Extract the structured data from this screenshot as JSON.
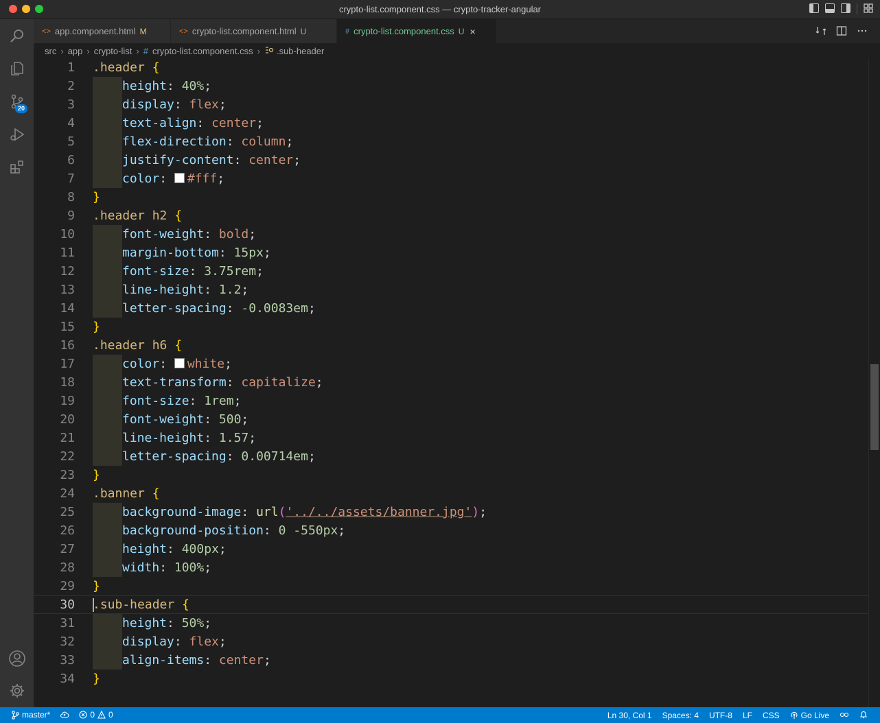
{
  "window": {
    "title": "crypto-list.component.css — crypto-tracker-angular"
  },
  "activity_bar": {
    "source_control_badge": "20",
    "items": [
      "search-icon",
      "explorer-icon",
      "source-control-icon",
      "run-debug-icon",
      "extensions-icon",
      "account-icon",
      "settings-gear-icon"
    ]
  },
  "tabs": [
    {
      "label": "app.component.html",
      "status": "M",
      "icon": "<>",
      "icon_color": "#e37933"
    },
    {
      "label": "crypto-list.component.html",
      "status": "U",
      "icon": "<>",
      "icon_color": "#e37933"
    },
    {
      "label": "crypto-list.component.css",
      "status": "U",
      "icon": "#",
      "icon_color": "#519aba",
      "active": true,
      "close": "×"
    }
  ],
  "breadcrumb": {
    "items": [
      "src",
      "app",
      "crypto-list",
      "crypto-list.component.css",
      ".sub-header"
    ],
    "file_icon": "#"
  },
  "editor": {
    "current_line": 30,
    "lines": [
      {
        "n": "1",
        "tokens": [
          [
            ".header",
            "sel"
          ],
          [
            " ",
            ""
          ],
          [
            "{",
            "brace"
          ]
        ]
      },
      {
        "n": "2",
        "indent": true,
        "tokens": [
          [
            "height",
            "prop"
          ],
          [
            ": ",
            ""
          ],
          [
            "40%",
            "num"
          ],
          [
            ";",
            ""
          ]
        ]
      },
      {
        "n": "3",
        "indent": true,
        "tokens": [
          [
            "display",
            "prop"
          ],
          [
            ": ",
            ""
          ],
          [
            "flex",
            "val"
          ],
          [
            ";",
            ""
          ]
        ]
      },
      {
        "n": "4",
        "indent": true,
        "tokens": [
          [
            "text-align",
            "prop"
          ],
          [
            ": ",
            ""
          ],
          [
            "center",
            "val"
          ],
          [
            ";",
            ""
          ]
        ]
      },
      {
        "n": "5",
        "indent": true,
        "tokens": [
          [
            "flex-direction",
            "prop"
          ],
          [
            ": ",
            ""
          ],
          [
            "column",
            "val"
          ],
          [
            ";",
            ""
          ]
        ]
      },
      {
        "n": "6",
        "indent": true,
        "tokens": [
          [
            "justify-content",
            "prop"
          ],
          [
            ": ",
            ""
          ],
          [
            "center",
            "val"
          ],
          [
            ";",
            ""
          ]
        ]
      },
      {
        "n": "7",
        "indent": true,
        "tokens": [
          [
            "color",
            "prop"
          ],
          [
            ": ",
            ""
          ],
          [
            "",
            "swatch"
          ],
          [
            "#fff",
            "val"
          ],
          [
            ";",
            ""
          ]
        ]
      },
      {
        "n": "8",
        "tokens": [
          [
            "}",
            "brace"
          ]
        ]
      },
      {
        "n": "9",
        "tokens": [
          [
            ".header h2",
            "sel"
          ],
          [
            " ",
            ""
          ],
          [
            "{",
            "brace"
          ]
        ]
      },
      {
        "n": "10",
        "indent": true,
        "tokens": [
          [
            "font-weight",
            "prop"
          ],
          [
            ": ",
            ""
          ],
          [
            "bold",
            "val"
          ],
          [
            ";",
            ""
          ]
        ]
      },
      {
        "n": "11",
        "indent": true,
        "tokens": [
          [
            "margin-bottom",
            "prop"
          ],
          [
            ": ",
            ""
          ],
          [
            "15px",
            "num"
          ],
          [
            ";",
            ""
          ]
        ]
      },
      {
        "n": "12",
        "indent": true,
        "tokens": [
          [
            "font-size",
            "prop"
          ],
          [
            ": ",
            ""
          ],
          [
            "3.75rem",
            "num"
          ],
          [
            ";",
            ""
          ]
        ]
      },
      {
        "n": "13",
        "indent": true,
        "tokens": [
          [
            "line-height",
            "prop"
          ],
          [
            ": ",
            ""
          ],
          [
            "1.2",
            "num"
          ],
          [
            ";",
            ""
          ]
        ]
      },
      {
        "n": "14",
        "indent": true,
        "tokens": [
          [
            "letter-spacing",
            "prop"
          ],
          [
            ": ",
            ""
          ],
          [
            "-0.0083em",
            "num"
          ],
          [
            ";",
            ""
          ]
        ]
      },
      {
        "n": "15",
        "tokens": [
          [
            "}",
            "brace"
          ]
        ]
      },
      {
        "n": "16",
        "tokens": [
          [
            ".header h6",
            "sel"
          ],
          [
            " ",
            ""
          ],
          [
            "{",
            "brace"
          ]
        ]
      },
      {
        "n": "17",
        "indent": true,
        "tokens": [
          [
            "color",
            "prop"
          ],
          [
            ": ",
            ""
          ],
          [
            "",
            "swatch"
          ],
          [
            "white",
            "val"
          ],
          [
            ";",
            ""
          ]
        ]
      },
      {
        "n": "18",
        "indent": true,
        "tokens": [
          [
            "text-transform",
            "prop"
          ],
          [
            ": ",
            ""
          ],
          [
            "capitalize",
            "val"
          ],
          [
            ";",
            ""
          ]
        ]
      },
      {
        "n": "19",
        "indent": true,
        "tokens": [
          [
            "font-size",
            "prop"
          ],
          [
            ": ",
            ""
          ],
          [
            "1rem",
            "num"
          ],
          [
            ";",
            ""
          ]
        ]
      },
      {
        "n": "20",
        "indent": true,
        "tokens": [
          [
            "font-weight",
            "prop"
          ],
          [
            ": ",
            ""
          ],
          [
            "500",
            "num"
          ],
          [
            ";",
            ""
          ]
        ]
      },
      {
        "n": "21",
        "indent": true,
        "tokens": [
          [
            "line-height",
            "prop"
          ],
          [
            ": ",
            ""
          ],
          [
            "1.57",
            "num"
          ],
          [
            ";",
            ""
          ]
        ]
      },
      {
        "n": "22",
        "indent": true,
        "tokens": [
          [
            "letter-spacing",
            "prop"
          ],
          [
            ": ",
            ""
          ],
          [
            "0.00714em",
            "num"
          ],
          [
            ";",
            ""
          ]
        ]
      },
      {
        "n": "23",
        "tokens": [
          [
            "}",
            "brace"
          ]
        ]
      },
      {
        "n": "24",
        "tokens": [
          [
            ".banner",
            "sel"
          ],
          [
            " ",
            ""
          ],
          [
            "{",
            "brace"
          ]
        ]
      },
      {
        "n": "25",
        "indent": true,
        "tokens": [
          [
            "background-image",
            "prop"
          ],
          [
            ": ",
            ""
          ],
          [
            "url",
            "fn"
          ],
          [
            "(",
            "paren"
          ],
          [
            "'../../assets/banner.jpg'",
            "str"
          ],
          [
            ")",
            "paren"
          ],
          [
            ";",
            ""
          ]
        ]
      },
      {
        "n": "26",
        "indent": true,
        "tokens": [
          [
            "background-position",
            "prop"
          ],
          [
            ": ",
            ""
          ],
          [
            "0 -550px",
            "num"
          ],
          [
            ";",
            ""
          ]
        ]
      },
      {
        "n": "27",
        "indent": true,
        "tokens": [
          [
            "height",
            "prop"
          ],
          [
            ": ",
            ""
          ],
          [
            "400px",
            "num"
          ],
          [
            ";",
            ""
          ]
        ]
      },
      {
        "n": "28",
        "indent": true,
        "tokens": [
          [
            "width",
            "prop"
          ],
          [
            ": ",
            ""
          ],
          [
            "100%",
            "num"
          ],
          [
            ";",
            ""
          ]
        ]
      },
      {
        "n": "29",
        "tokens": [
          [
            "}",
            "brace"
          ]
        ]
      },
      {
        "n": "30",
        "tokens": [
          [
            ".sub-header",
            "sel"
          ],
          [
            " ",
            ""
          ],
          [
            "{",
            "brace"
          ]
        ]
      },
      {
        "n": "31",
        "indent": true,
        "tokens": [
          [
            "height",
            "prop"
          ],
          [
            ": ",
            ""
          ],
          [
            "50%",
            "num"
          ],
          [
            ";",
            ""
          ]
        ]
      },
      {
        "n": "32",
        "indent": true,
        "tokens": [
          [
            "display",
            "prop"
          ],
          [
            ": ",
            ""
          ],
          [
            "flex",
            "val"
          ],
          [
            ";",
            ""
          ]
        ]
      },
      {
        "n": "33",
        "indent": true,
        "tokens": [
          [
            "align-items",
            "prop"
          ],
          [
            ": ",
            ""
          ],
          [
            "center",
            "val"
          ],
          [
            ";",
            ""
          ]
        ]
      },
      {
        "n": "34",
        "tokens": [
          [
            "}",
            "brace"
          ]
        ]
      }
    ]
  },
  "status_bar": {
    "branch": "master*",
    "errors": "0",
    "warnings": "0",
    "cursor_position": "Ln 30, Col 1",
    "indentation": "Spaces: 4",
    "encoding": "UTF-8",
    "line_ending": "LF",
    "language": "CSS",
    "go_live": "Go Live",
    "background": "#007acc"
  }
}
